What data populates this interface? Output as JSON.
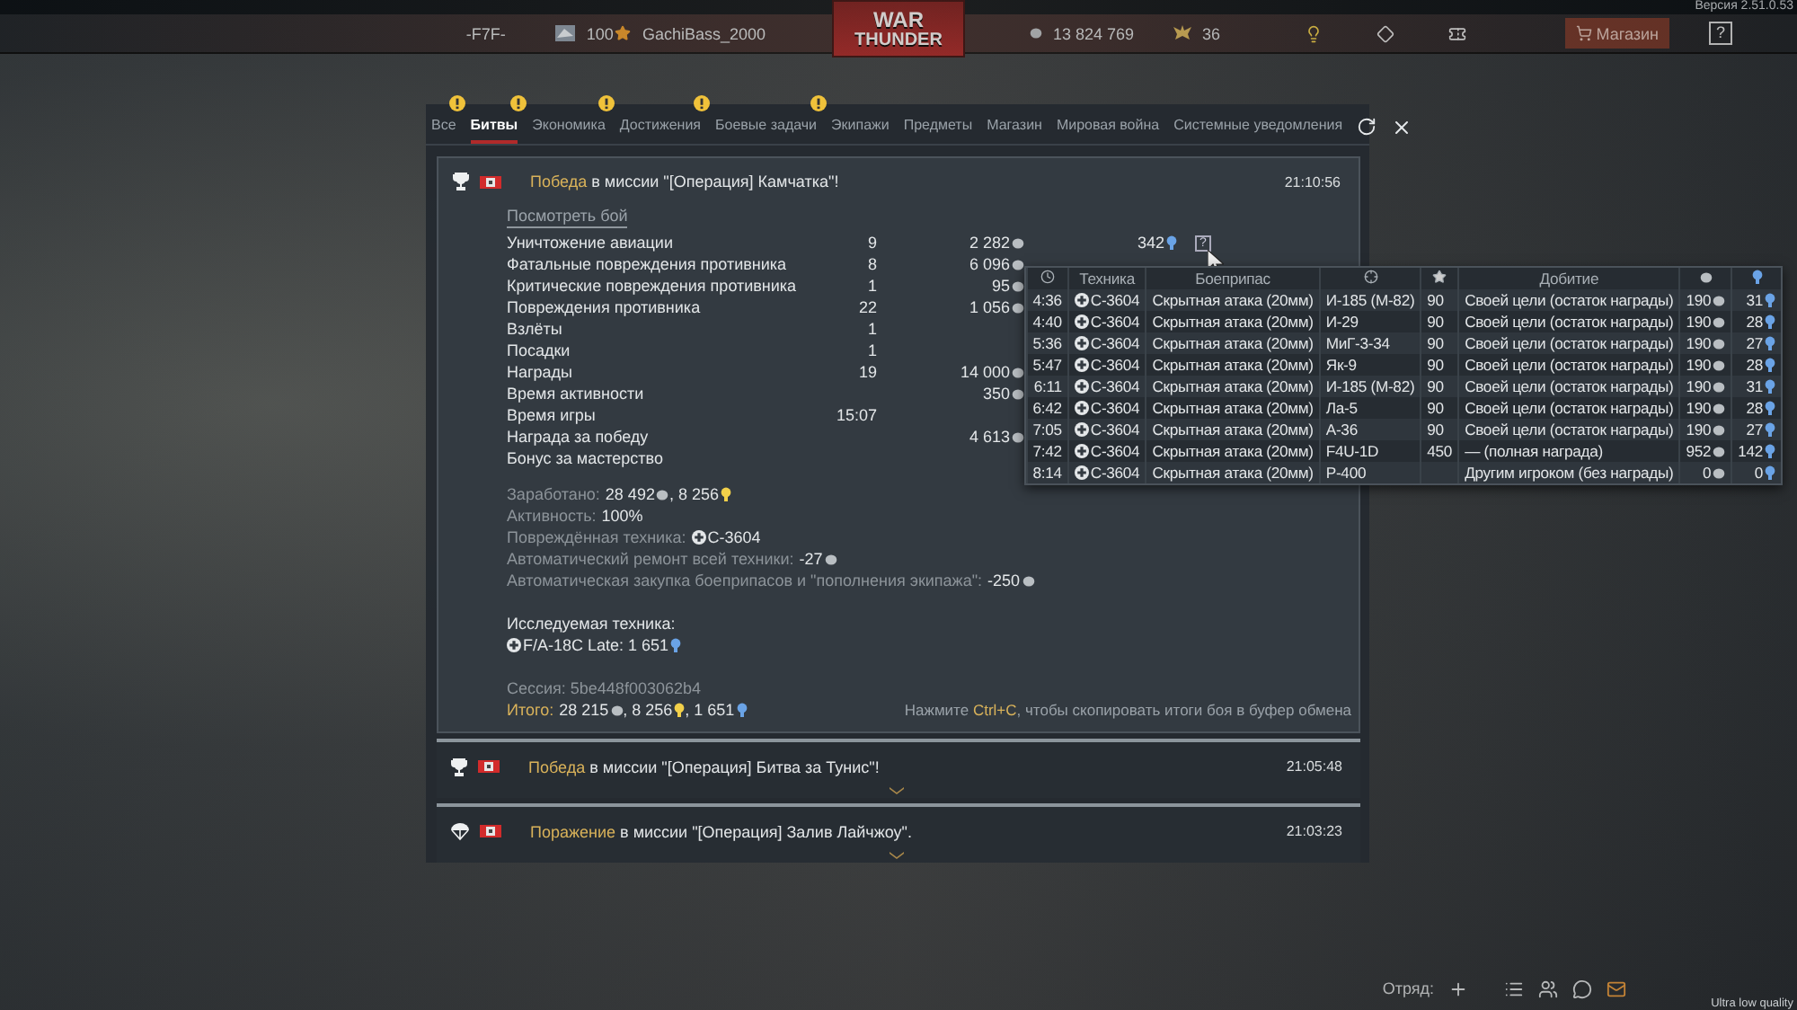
{
  "top_bar": {
    "version": "Версия 2.51.0.53",
    "squad_tag": "-F7F-",
    "rank": "100",
    "nickname": "GachiBass_2000",
    "logo": [
      "WAR",
      "THUNDER"
    ],
    "silver": "13 824 769",
    "gold": "36",
    "shop": "Магазин",
    "help": "?"
  },
  "tabs": [
    {
      "label": "Все",
      "selected": false,
      "alert": true
    },
    {
      "label": "Битвы",
      "selected": true,
      "alert": true
    },
    {
      "label": "Экономика",
      "selected": false,
      "alert": true
    },
    {
      "label": "Достижения",
      "selected": false,
      "alert": true
    },
    {
      "label": "Боевые задачи",
      "selected": false,
      "alert": true
    },
    {
      "label": "Экипажи",
      "selected": false,
      "alert": false
    },
    {
      "label": "Предметы",
      "selected": false,
      "alert": false
    },
    {
      "label": "Магазин",
      "selected": false,
      "alert": false
    },
    {
      "label": "Мировая война",
      "selected": false,
      "alert": false
    },
    {
      "label": "Системные уведомления",
      "selected": false,
      "alert": false
    }
  ],
  "messages": [
    {
      "kind": "victory",
      "result": "Победа",
      "text": "в миссии \"[Операция] Камчатка\"!",
      "time": "21:10:56",
      "expanded": true
    },
    {
      "kind": "victory",
      "result": "Победа",
      "text": "в миссии \"[Операция] Битва за Тунис\"!",
      "time": "21:05:48",
      "expanded": false
    },
    {
      "kind": "defeat",
      "result": "Поражение",
      "text": "в миссии \"[Операция] Залив Лайчжоу\".",
      "time": "21:03:23",
      "expanded": false
    }
  ],
  "battle_report": {
    "replay_link": "Посмотреть бой",
    "stats": [
      {
        "label": "Уничтожение авиации",
        "count": "9",
        "silver": "2 282",
        "rp": "342",
        "help": "?"
      },
      {
        "label": "Фатальные повреждения противника",
        "count": "8",
        "silver": "6 096"
      },
      {
        "label": "Критические повреждения противника",
        "count": "1",
        "silver": "95"
      },
      {
        "label": "Повреждения противника",
        "count": "22",
        "silver": "1 056"
      },
      {
        "label": "Взлёты",
        "count": "1"
      },
      {
        "label": "Посадки",
        "count": "1"
      },
      {
        "label": "Награды",
        "count": "19",
        "silver": "14 000"
      },
      {
        "label": "Время активности",
        "silver": "350"
      },
      {
        "label": "Время игры",
        "count": "15:07"
      },
      {
        "label": "Награда за победу",
        "silver": "4 613"
      },
      {
        "label": "Бонус за мастерство"
      }
    ],
    "summary": [
      {
        "label": "Заработано:",
        "parts": [
          {
            "text": "28 492",
            "kind": "silver"
          },
          {
            "text": ", 8 256",
            "kind": "research"
          }
        ]
      },
      {
        "label": "Активность:",
        "parts": [
          {
            "text": "100%"
          }
        ]
      },
      {
        "label": "Повреждённая техника:",
        "parts": [
          {
            "text": "С-3604",
            "kind": "vehicle"
          }
        ]
      },
      {
        "label": "Автоматический ремонт всей техники:",
        "parts": [
          {
            "text": "-27",
            "kind": "silver"
          }
        ]
      },
      {
        "label": "Автоматическая закупка боеприпасов и \"пополнения экипажа\":",
        "parts": [
          {
            "text": "-250",
            "kind": "silver"
          }
        ]
      }
    ],
    "research_title": "Исследуемая техника:",
    "research": {
      "parts": [
        {
          "text": "F/A-18C Late:",
          "kind": "vehicle"
        },
        {
          "text": " 1 651",
          "kind": "vehicle_research"
        }
      ]
    },
    "session": "Сессия: 5be448f003062b4",
    "total": {
      "label": "Итого:",
      "parts": [
        {
          "text": "28 215",
          "kind": "silver"
        },
        {
          "text": ", 8 256",
          "kind": "research"
        },
        {
          "text": ", 1 651",
          "kind": "vehicle_research"
        }
      ]
    },
    "hint": {
      "before": "Нажмите ",
      "key": "Ctrl+C",
      "after": ", чтобы скопировать итоги боя в буфер обмена"
    }
  },
  "tooltip": {
    "headers": {
      "vehicle": "Техника",
      "ammo": "Боеприпас",
      "finish": "Добитие"
    },
    "rows": [
      {
        "time": "4:36",
        "vehicle": "С-3604",
        "ammo": "Скрытная атака (20мм)",
        "target": "И-185 (М-82)",
        "score": "90",
        "finish": "Своей цели (остаток награды)",
        "silver": "190",
        "rp": "31"
      },
      {
        "time": "4:40",
        "vehicle": "С-3604",
        "ammo": "Скрытная атака (20мм)",
        "target": "И-29",
        "score": "90",
        "finish": "Своей цели (остаток награды)",
        "silver": "190",
        "rp": "28"
      },
      {
        "time": "5:36",
        "vehicle": "С-3604",
        "ammo": "Скрытная атака (20мм)",
        "target": "МиГ-3-34",
        "score": "90",
        "finish": "Своей цели (остаток награды)",
        "silver": "190",
        "rp": "27"
      },
      {
        "time": "5:47",
        "vehicle": "С-3604",
        "ammo": "Скрытная атака (20мм)",
        "target": "Як-9",
        "score": "90",
        "finish": "Своей цели (остаток награды)",
        "silver": "190",
        "rp": "28"
      },
      {
        "time": "6:11",
        "vehicle": "С-3604",
        "ammo": "Скрытная атака (20мм)",
        "target": "И-185 (М-82)",
        "score": "90",
        "finish": "Своей цели (остаток награды)",
        "silver": "190",
        "rp": "31"
      },
      {
        "time": "6:42",
        "vehicle": "С-3604",
        "ammo": "Скрытная атака (20мм)",
        "target": "Ла-5",
        "score": "90",
        "finish": "Своей цели (остаток награды)",
        "silver": "190",
        "rp": "28"
      },
      {
        "time": "7:05",
        "vehicle": "С-3604",
        "ammo": "Скрытная атака (20мм)",
        "target": "А-36",
        "score": "90",
        "finish": "Своей цели (остаток награды)",
        "silver": "190",
        "rp": "27"
      },
      {
        "time": "7:42",
        "vehicle": "С-3604",
        "ammo": "Скрытная атака (20мм)",
        "target": "F4U-1D",
        "score": "450",
        "finish": "— (полная награда)",
        "silver": "952",
        "rp": "142"
      },
      {
        "time": "8:14",
        "vehicle": "С-3604",
        "ammo": "Скрытная атака (20мм)",
        "target": "P-400",
        "finish": "Другим игроком (без награды)",
        "silver": "0",
        "rp": "0"
      }
    ]
  },
  "bottom_bar": {
    "squad_label": "Отряд:",
    "quality": "Ultra low quality"
  }
}
